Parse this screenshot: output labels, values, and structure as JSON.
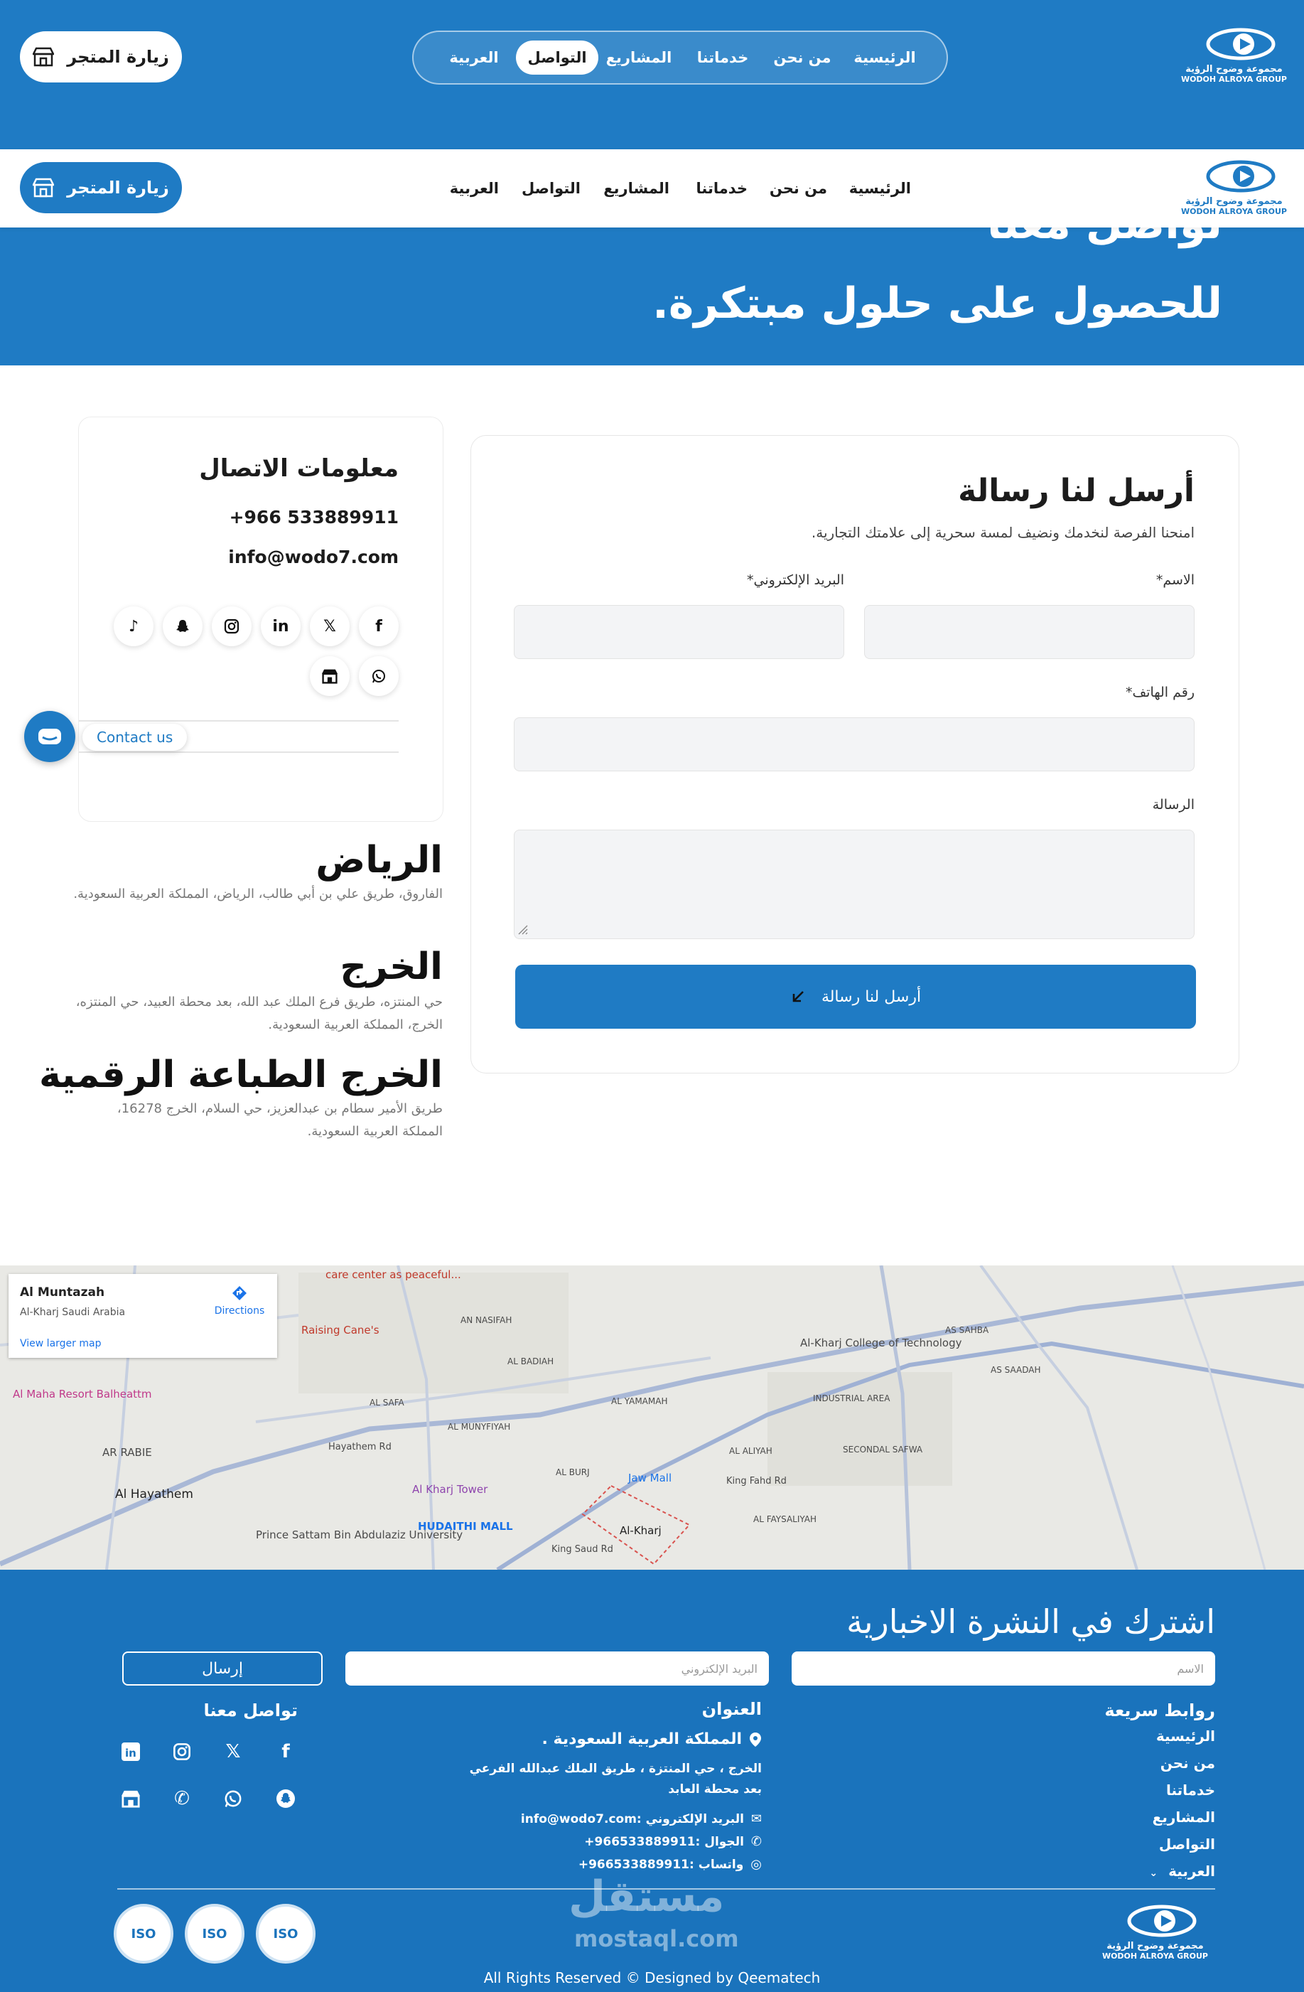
{
  "nav": {
    "items": [
      "الرئيسية",
      "من نحن",
      "خدماتنا",
      "المشاريع",
      "التواصل",
      "العربية"
    ],
    "active": "التواصل",
    "store_button": "زيارة المتجر"
  },
  "logo": {
    "arabic": "مجموعة وضوح الرؤية",
    "english": "WODOH ALROYA GROUP"
  },
  "hero": {
    "line1": "تواصل معنا",
    "line2": "للحصول على حلول مبتكرة."
  },
  "contact_info": {
    "title": "معلومات الاتصال",
    "phone": "+966 533889911",
    "email": "info@wodo7.com",
    "social_icons": [
      "facebook-icon",
      "x-icon",
      "linkedin-icon",
      "instagram-icon",
      "snapchat-icon",
      "tiktok-icon",
      "whatsapp-icon",
      "store-icon"
    ]
  },
  "floating_contact": {
    "label": "Contact us"
  },
  "branches": [
    {
      "name": "الرياض",
      "address": "الفاروق، طريق علي بن أبي طالب، الرياض، المملكة العربية السعودية."
    },
    {
      "name": "الخرج",
      "address": "حي المنتزه، طريق فرع الملك عبد الله، بعد محطة العبيد، حي المنتزه، الخرج، المملكة العربية السعودية."
    },
    {
      "name": "الخرج الطباعة الرقمية",
      "address": "طريق الأمير سطام بن عبدالعزيز، حي السلام، الخرج 16278، المملكة العربية السعودية."
    }
  ],
  "form": {
    "title": "أرسل لنا رسالة",
    "subtitle": "امنحنا الفرصة لنخدمك ونضيف لمسة سحرية إلى علامتك التجارية.",
    "name_label": "الاسم*",
    "email_label": "البريد الإلكتروني*",
    "phone_label": "رقم الهاتف*",
    "message_label": "الرسالة",
    "submit_label": "أرسل لنا رسالة"
  },
  "map": {
    "place_name": "Al Muntazah",
    "place_region": "Al-Kharj Saudi Arabia",
    "directions": "Directions",
    "larger_map": "View larger map",
    "labels": [
      "care center as peaceful...",
      "Raising Cane's",
      "Al Maha Resort Balheattm",
      "AR RABIE",
      "Al Hayathem",
      "Prince Sattam Bin Abdulaziz University",
      "HUDAITHI MALL",
      "Al Kharj Tower",
      "Jaw Mall",
      "Al-Kharj",
      "Al-Kharj College of Technology",
      "INDUSTRIAL AREA",
      "AL YAMAMAH",
      "AL MUNYFIYAH",
      "AL SAFA",
      "AL BADIAH",
      "AN NASIFAH",
      "AL ALIYAH",
      "AL BURJ",
      "AL FAYSALIYAH",
      "SECONDAL SAFWA",
      "AS SAHBA",
      "AS SAADAH",
      "King Fahd Rd",
      "King Saud Rd",
      "Hayathem Rd"
    ]
  },
  "footer": {
    "newsletter_title": "اشترك في النشرة الاخبارية",
    "name_placeholder": "الاسم",
    "email_placeholder": "البريد الإلكتروني",
    "send": "إرسال",
    "quick_links_title": "روابط سريعة",
    "quick_links": [
      "الرئيسية",
      "من نحن",
      "خدماتنا",
      "المشاريع",
      "التواصل",
      "العربية"
    ],
    "address_title": "العنوان",
    "country": "المملكة العربية السعودية .",
    "address_detail": "الخرج ، حي المنتزة ، طريق الملك عبدالله الفرعي بعد محطة العابد",
    "email_line": "البريد الإلكتروني :info@wodo7.com",
    "mobile_line": "الجوال :966533889911+",
    "whatsapp_line": "واتساب :966533889911+",
    "contact_title": "تواصل معنا",
    "copyright": "All Rights Reserved © Designed by  Qeematech",
    "iso_badges": [
      "ISO",
      "ISO",
      "ISO"
    ],
    "watermark": "مستقل",
    "watermark_sub": "mostaql.com"
  }
}
